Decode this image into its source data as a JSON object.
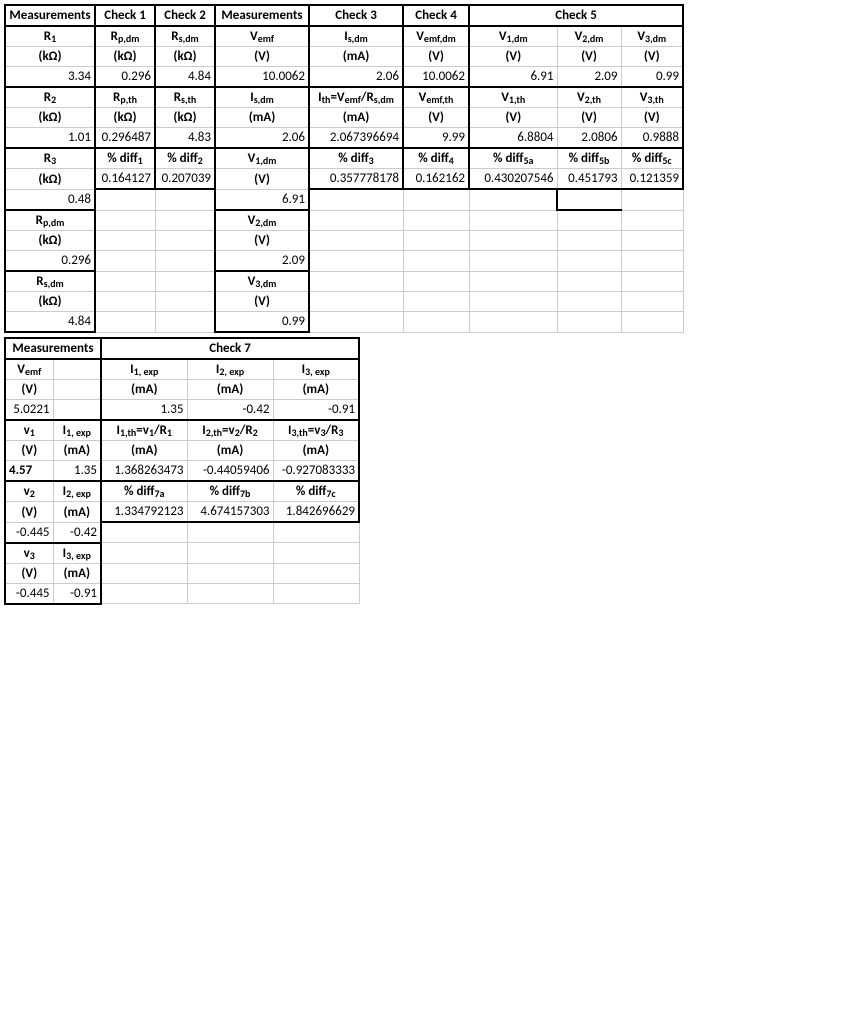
{
  "top": {
    "h": {
      "meas": "Measurements",
      "c1": "Check 1",
      "c2": "Check 2",
      "meas2": "Measurements",
      "c3": "Check 3",
      "c4": "Check 4",
      "c5": "Check 5"
    },
    "r2": {
      "a": "R₁",
      "b": "Rp,dm",
      "c": "Rs,dm",
      "d": "Vemf",
      "e": "Is,dm",
      "f": "Vemf,dm",
      "g": "V1,dm",
      "h": "V2,dm",
      "i": "V3,dm"
    },
    "r3": {
      "a": "(kΩ)",
      "b": "(kΩ)",
      "c": "(kΩ)",
      "d": "(V)",
      "e": "(mA)",
      "f": "(V)",
      "g": "(V)",
      "h": "(V)",
      "i": "(V)"
    },
    "r4": {
      "a": "3.34",
      "b": "0.296",
      "c": "4.84",
      "d": "10.0062",
      "e": "2.06",
      "f": "10.0062",
      "g": "6.91",
      "h": "2.09",
      "i": "0.99"
    },
    "r5": {
      "a": "R₂",
      "b": "Rp,th",
      "c": "Rs,th",
      "d": "Is,dm",
      "e": "Ith=Vemf/Rs,dm",
      "f": "Vemf,th",
      "g": "V1,th",
      "h": "V2,th",
      "i": "V3,th"
    },
    "r6": {
      "a": "(kΩ)",
      "b": "(kΩ)",
      "c": "(kΩ)",
      "d": "(mA)",
      "e": "(mA)",
      "f": "(V)",
      "g": "(V)",
      "h": "(V)",
      "i": "(V)"
    },
    "r7": {
      "a": "1.01",
      "b": "0.296487",
      "c": "4.83",
      "d": "2.06",
      "e": "2.067396694",
      "f": "9.99",
      "g": "6.8804",
      "h": "2.0806",
      "i": "0.9888"
    },
    "r8": {
      "a": "R₃",
      "b": "% diff₁",
      "c": "% diff₂",
      "d": "V1,dm",
      "e": "% diff₃",
      "f": "% diff₄",
      "g": "% diff5a",
      "h": "% diff5b",
      "i": "% diff5c"
    },
    "r9": {
      "a": "(kΩ)",
      "b": "0.164127",
      "c": "0.207039",
      "d": "(V)",
      "e": "0.357778178",
      "f": "0.162162",
      "g": "0.430207546",
      "h": "0.451793",
      "i": "0.121359"
    },
    "r10": {
      "a": "0.48",
      "d": "6.91"
    },
    "r11": {
      "a": "Rp,dm",
      "d": "V2,dm"
    },
    "r12": {
      "a": "(kΩ)",
      "d": "(V)"
    },
    "r13": {
      "a": "0.296",
      "d": "2.09"
    },
    "r14": {
      "a": "Rs,dm",
      "d": "V3,dm"
    },
    "r15": {
      "a": "(kΩ)",
      "d": "(V)"
    },
    "r16": {
      "a": "4.84",
      "d": "0.99"
    }
  },
  "bot": {
    "h": {
      "meas": "Measurements",
      "c7": "Check 7"
    },
    "r2": {
      "a": "Vemf",
      "c": "I1, exp",
      "d": "I2, exp",
      "e": "I3, exp"
    },
    "r3": {
      "a": "(V)",
      "c": "(mA)",
      "d": "(mA)",
      "e": "(mA)"
    },
    "r4": {
      "a": "5.0221",
      "c": "1.35",
      "d": "-0.42",
      "e": "-0.91"
    },
    "r5": {
      "a": "v₁",
      "b": "I1, exp",
      "c": "I1,th=v₁/R₁",
      "d": "I2,th=v₂/R₂",
      "e": "I3,th=v₃/R₃"
    },
    "r6": {
      "a": "(V)",
      "b": "(mA)",
      "c": "(mA)",
      "d": "(mA)",
      "e": "(mA)"
    },
    "r7": {
      "a": "4.57",
      "b": "1.35",
      "c": "1.368263473",
      "d": "-0.44059406",
      "e": "-0.927083333"
    },
    "r8": {
      "a": "v₂",
      "b": "I2, exp",
      "c": "% diff7a",
      "d": "% diff7b",
      "e": "% diff7c"
    },
    "r9": {
      "a": "(V)",
      "b": "(mA)",
      "c": "1.334792123",
      "d": "4.674157303",
      "e": "1.842696629"
    },
    "r10": {
      "a": "-0.445",
      "b": "-0.42"
    },
    "r11": {
      "a": "v₃",
      "b": "I3, exp"
    },
    "r12": {
      "a": "(V)",
      "b": "(mA)"
    },
    "r13": {
      "a": "-0.445",
      "b": "-0.91"
    }
  }
}
